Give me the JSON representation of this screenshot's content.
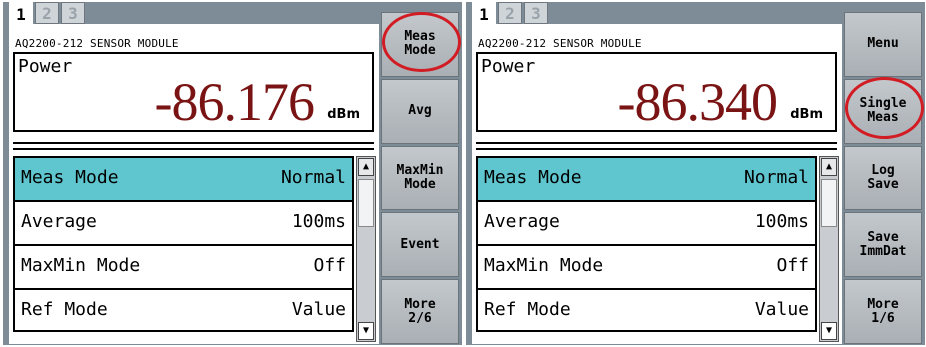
{
  "colors": {
    "panel_bg": "#7e8c98",
    "selected_row": "#5fc6cf",
    "reading_value": "#7a1414",
    "highlight_ring": "#d21c24"
  },
  "panels": [
    {
      "tabs": [
        "1",
        "2",
        "3"
      ],
      "active_tab": "1",
      "module_title": "AQ2200-212 SENSOR MODULE",
      "readout": {
        "label": "Power",
        "value": "-86.176",
        "unit": "dBm"
      },
      "settings": [
        {
          "label": "Meas Mode",
          "value": "Normal",
          "selected": true
        },
        {
          "label": "Average",
          "value": "100ms",
          "selected": false
        },
        {
          "label": "MaxMin Mode",
          "value": "Off",
          "selected": false
        },
        {
          "label": "Ref Mode",
          "value": "Value",
          "selected": false
        }
      ],
      "softkeys": [
        "Meas\nMode",
        "Avg",
        "MaxMin\nMode",
        "Event",
        "More\n2/6"
      ],
      "highlighted_softkey": "Meas Mode"
    },
    {
      "tabs": [
        "1",
        "2",
        "3"
      ],
      "active_tab": "1",
      "module_title": "AQ2200-212 SENSOR MODULE",
      "readout": {
        "label": "Power",
        "value": "-86.340",
        "unit": "dBm"
      },
      "settings": [
        {
          "label": "Meas Mode",
          "value": "Normal",
          "selected": true
        },
        {
          "label": "Average",
          "value": "100ms",
          "selected": false
        },
        {
          "label": "MaxMin Mode",
          "value": "Off",
          "selected": false
        },
        {
          "label": "Ref Mode",
          "value": "Value",
          "selected": false
        }
      ],
      "softkeys": [
        "Menu",
        "Single\nMeas",
        "Log\nSave",
        "Save\nImmDat",
        "More\n1/6"
      ],
      "highlighted_softkey": "Single Meas"
    }
  ]
}
